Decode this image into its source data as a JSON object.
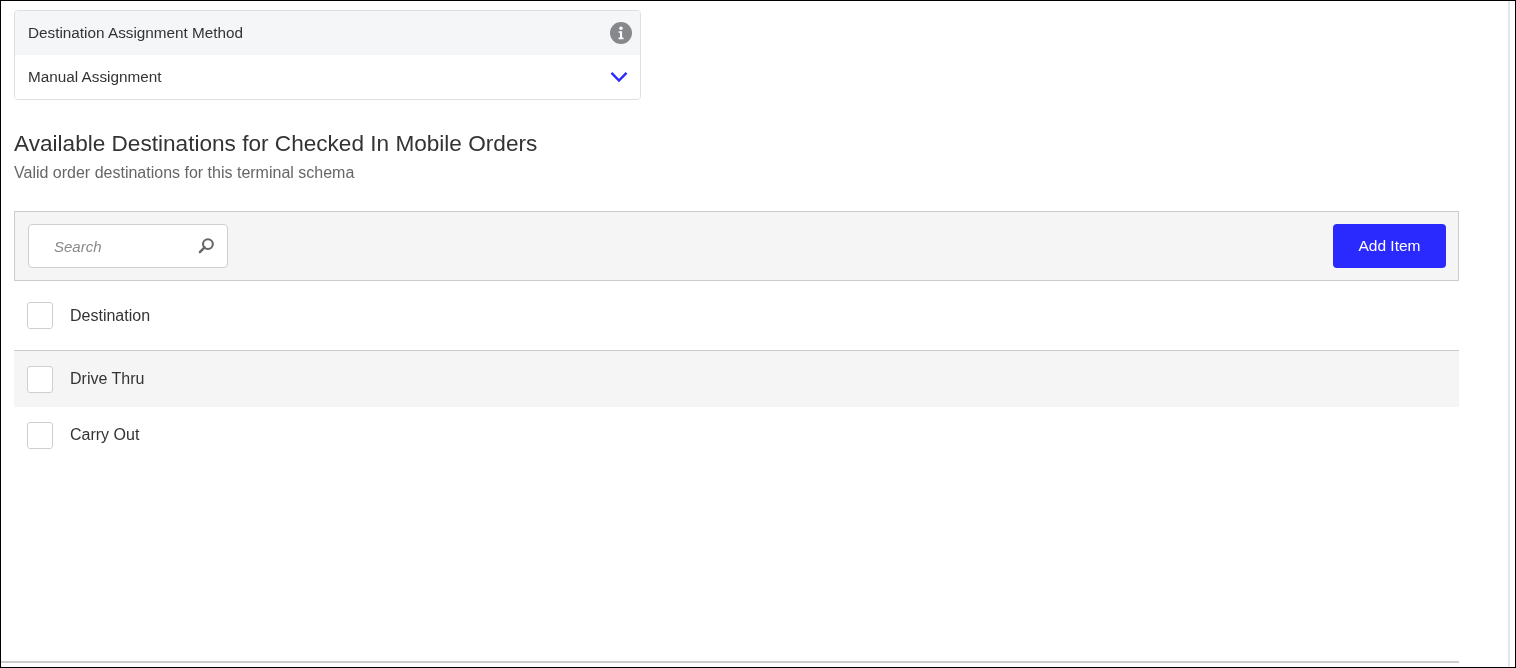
{
  "assignment": {
    "label": "Destination Assignment Method",
    "value": "Manual Assignment"
  },
  "section": {
    "title": "Available Destinations for Checked In Mobile Orders",
    "subtitle": "Valid order destinations for this terminal schema"
  },
  "toolbar": {
    "search": {
      "placeholder": "Search"
    },
    "button": "Add Item"
  },
  "table": {
    "select_all": {
      "checked": false
    },
    "columns": [
      "Destination"
    ],
    "rows": [
      {
        "cells": [
          "Drive Thru"
        ],
        "checked": false
      },
      {
        "cells": [
          "Carry Out"
        ],
        "checked": false
      }
    ]
  }
}
